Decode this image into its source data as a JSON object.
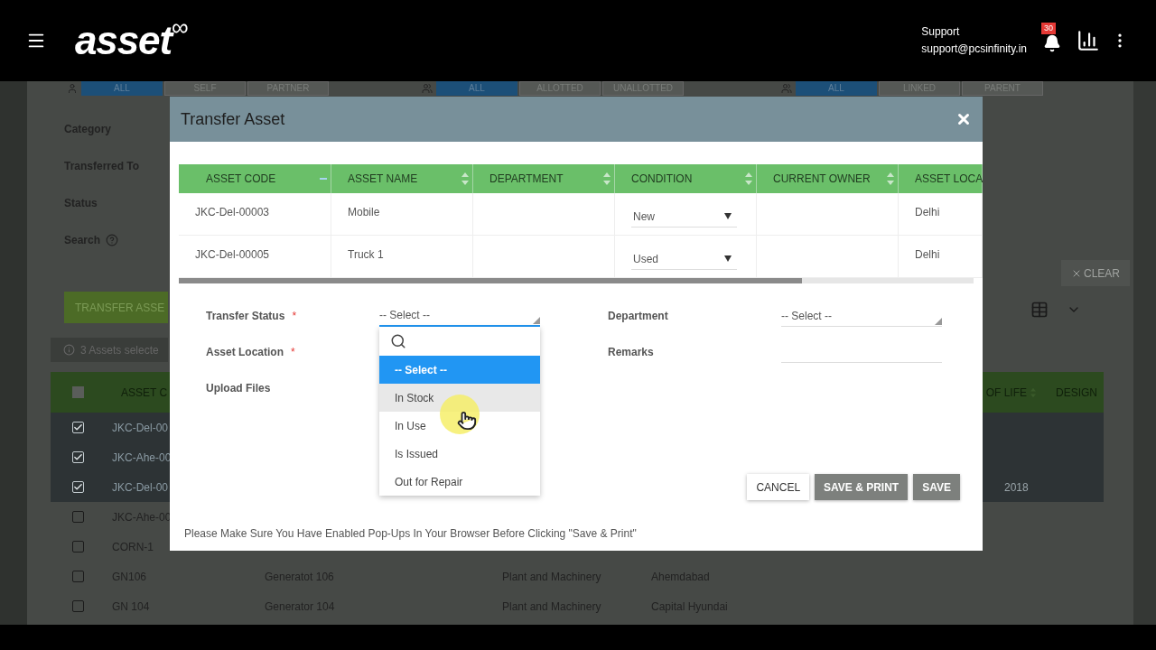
{
  "header": {
    "logo": "asset",
    "logo_mark": "∞",
    "support_label": "Support",
    "support_email": "support@pcsinfinity.in",
    "notification_count": "30"
  },
  "background": {
    "tab_groups": [
      [
        {
          "label": "ALL",
          "selected": true
        },
        {
          "label": "SELF",
          "selected": false
        },
        {
          "label": "PARTNER",
          "selected": false
        }
      ],
      [
        {
          "label": "ALL",
          "selected": true
        },
        {
          "label": "ALLOTTED",
          "selected": false
        },
        {
          "label": "UNALLOTTED",
          "selected": false
        }
      ],
      [
        {
          "label": "ALL",
          "selected": true
        },
        {
          "label": "LINKED",
          "selected": false
        },
        {
          "label": "PARENT",
          "selected": false
        }
      ]
    ],
    "filters": [
      "Category",
      "Transferred To",
      "Status",
      "Search"
    ],
    "transfer_button": "TRANSFER ASSE",
    "selection_info": "3 Assets selecte",
    "clear_button": "CLEAR",
    "table": {
      "select_all_checked": false,
      "columns": [
        "ASSET C",
        "OF LIFE",
        "DESIGN"
      ],
      "rows": [
        {
          "checked": true,
          "code": "JKC-Del-00"
        },
        {
          "checked": true,
          "code": "JKC-Ahe-00"
        },
        {
          "checked": true,
          "code": "JKC-Del-00",
          "year": "2018"
        },
        {
          "checked": false,
          "code": "JKC-Ahe-00"
        },
        {
          "checked": false,
          "code": "CORN-1"
        },
        {
          "checked": false,
          "code": "GN106",
          "name": "Generatot 106",
          "category": "Plant and Machinery",
          "location": "Ahemdabad"
        },
        {
          "checked": false,
          "code": "GN 104",
          "name": "Generator 104",
          "category": "Plant and Machinery",
          "location": "Capital Hyundai"
        }
      ]
    }
  },
  "dialog": {
    "title": "Transfer Asset",
    "table": {
      "columns": [
        {
          "label": "ASSET CODE",
          "sorted": true
        },
        {
          "label": "ASSET NAME",
          "sorted": false
        },
        {
          "label": "DEPARTMENT",
          "sorted": false
        },
        {
          "label": "CONDITION",
          "sorted": false
        },
        {
          "label": "CURRENT OWNER",
          "sorted": false
        },
        {
          "label": "ASSET LOCA"
        }
      ],
      "rows": [
        {
          "cells": [
            {
              "kind": "text",
              "text": "JKC-Del-00003"
            },
            {
              "kind": "text",
              "text": "Mobile"
            },
            {
              "kind": "empty"
            },
            {
              "kind": "select",
              "text": "New"
            },
            {
              "kind": "empty"
            },
            {
              "kind": "text",
              "text": "Delhi"
            }
          ]
        },
        {
          "cells": [
            {
              "kind": "text",
              "text": "JKC-Del-00005"
            },
            {
              "kind": "text",
              "text": "Truck 1"
            },
            {
              "kind": "empty"
            },
            {
              "kind": "select",
              "text": "Used"
            },
            {
              "kind": "empty"
            },
            {
              "kind": "text",
              "text": "Delhi"
            }
          ]
        }
      ]
    },
    "left_fields": [
      {
        "label": "Transfer Status",
        "required_mark": "*",
        "kind": "select",
        "value": "-- Select --",
        "focused": true
      },
      {
        "label": "Asset Location",
        "required_mark": "*",
        "kind": "label"
      },
      {
        "label": "Upload Files",
        "kind": "label"
      }
    ],
    "right_fields": [
      {
        "label": "Department",
        "kind": "select",
        "value": "-- Select --",
        "focused": false
      },
      {
        "label": "Remarks",
        "kind": "text"
      }
    ],
    "dropdown": {
      "options": [
        {
          "label": "-- Select --",
          "selected": true,
          "hovered": false
        },
        {
          "label": "In Stock",
          "selected": false,
          "hovered": true
        },
        {
          "label": "In Use",
          "selected": false,
          "hovered": false
        },
        {
          "label": "Is Issued",
          "selected": false,
          "hovered": false
        },
        {
          "label": "Out for Repair",
          "selected": false,
          "hovered": false
        }
      ]
    },
    "buttons": [
      {
        "label": "CANCEL",
        "kind": "flat"
      },
      {
        "label": "SAVE & PRINT",
        "kind": "raised"
      },
      {
        "label": "SAVE",
        "kind": "raised"
      }
    ],
    "note": "Please Make Sure You Have Enabled Pop-Ups In Your Browser Before Clicking \"Save & Print\""
  }
}
